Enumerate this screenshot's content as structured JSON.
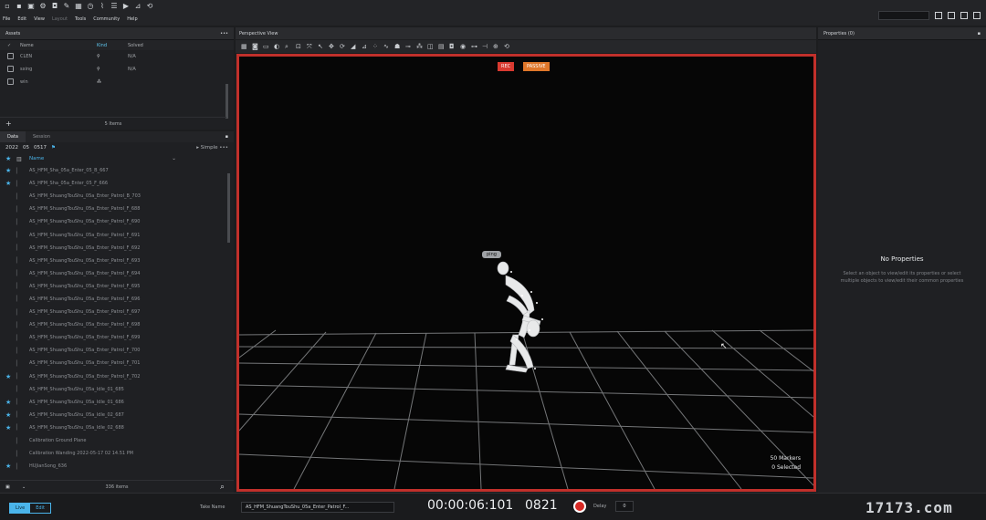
{
  "menu": {
    "items": [
      "File",
      "Edit",
      "View",
      "Layout",
      "Tools",
      "Community",
      "Help"
    ]
  },
  "assets": {
    "title": "Assets",
    "columns": {
      "name": "Name",
      "kind": "Kind",
      "solved": "Solved"
    },
    "rows": [
      {
        "name": "CLEN",
        "solved": "N/A"
      },
      {
        "name": "sxing",
        "solved": "N/A"
      },
      {
        "name": "win",
        "solved": ""
      }
    ],
    "footer": "5 Items"
  },
  "data": {
    "tabs": [
      "Data",
      "Session"
    ],
    "crumb": {
      "a": "2022",
      "b": "05",
      "c": "0517",
      "view": "Simple"
    },
    "column_name": "Name",
    "takes": [
      {
        "name": "AS_HFM_Sha_05a_Enter_05_B_667",
        "star": true
      },
      {
        "name": "AS_HFM_Sha_05a_Enter_05_F_666",
        "star": true
      },
      {
        "name": "AS_HFM_ShuangTouShu_05a_Enter_Patrol_B_703",
        "star": false
      },
      {
        "name": "AS_HFM_ShuangTouShu_05a_Enter_Patrol_F_688",
        "star": false
      },
      {
        "name": "AS_HFM_ShuangTouShu_05a_Enter_Patrol_F_690",
        "star": false
      },
      {
        "name": "AS_HFM_ShuangTouShu_05a_Enter_Patrol_F_691",
        "star": false
      },
      {
        "name": "AS_HFM_ShuangTouShu_05a_Enter_Patrol_F_692",
        "star": false
      },
      {
        "name": "AS_HFM_ShuangTouShu_05a_Enter_Patrol_F_693",
        "star": false
      },
      {
        "name": "AS_HFM_ShuangTouShu_05a_Enter_Patrol_F_694",
        "star": false
      },
      {
        "name": "AS_HFM_ShuangTouShu_05a_Enter_Patrol_F_695",
        "star": false
      },
      {
        "name": "AS_HFM_ShuangTouShu_05a_Enter_Patrol_F_696",
        "star": false
      },
      {
        "name": "AS_HFM_ShuangTouShu_05a_Enter_Patrol_F_697",
        "star": false
      },
      {
        "name": "AS_HFM_ShuangTouShu_05a_Enter_Patrol_F_698",
        "star": false
      },
      {
        "name": "AS_HFM_ShuangTouShu_05a_Enter_Patrol_F_699",
        "star": false
      },
      {
        "name": "AS_HFM_ShuangTouShu_05a_Enter_Patrol_F_700",
        "star": false
      },
      {
        "name": "AS_HFM_ShuangTouShu_05a_Enter_Patrol_F_701",
        "star": false
      },
      {
        "name": "AS_HFM_ShuangTouShu_05a_Enter_Patrol_F_702",
        "star": true
      },
      {
        "name": "AS_HFM_ShuangTouShu_05a_Idle_01_685",
        "star": false
      },
      {
        "name": "AS_HFM_ShuangTouShu_05a_Idle_01_686",
        "star": true
      },
      {
        "name": "AS_HFM_ShuangTouShu_05a_Idle_02_687",
        "star": true
      },
      {
        "name": "AS_HFM_ShuangTouShu_05a_Idle_02_688",
        "star": true
      },
      {
        "name": "Calibration Ground Plane",
        "star": false
      },
      {
        "name": "Calibration Wanding 2022-05-17 02 14.51 PM",
        "star": false
      },
      {
        "name": "HUJianSong_636",
        "star": true
      }
    ],
    "footer": "336 items"
  },
  "viewport": {
    "title": "Perspective View",
    "rec_badge": "REC",
    "mode_badge": "PASSIVE",
    "markers": "50 Markers",
    "selected": "0 Selected",
    "label": "ping"
  },
  "properties": {
    "title": "Properties (0)",
    "empty_title": "No Properties",
    "hint": "Select an object to view/edit its properties or select multiple objects to view/edit their common properties"
  },
  "bottom": {
    "live": "Live",
    "edit": "Edit",
    "take_label": "Take Name",
    "take_value": "AS_HFM_ShuangTouShu_05a_Enter_Patrol_F...",
    "timecode": "00:00:06:101",
    "frame": "0821",
    "delay_label": "Delay",
    "delay_value": "0"
  },
  "watermark": "17173.com",
  "colors": {
    "accent": "#4ab4ea",
    "rec_border": "#c1302b",
    "rec_badge": "#d93a30",
    "mode_badge": "#e0772a"
  }
}
